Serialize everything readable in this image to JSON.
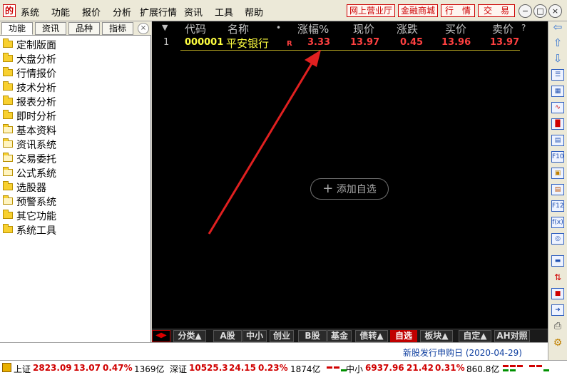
{
  "menu": {
    "logo_glyph": "的",
    "items": [
      "系统",
      "功能",
      "报价",
      "分析",
      "扩展行情",
      "资讯",
      "工具",
      "帮助"
    ],
    "quick_buttons": [
      "网上营业厅",
      "金融商城",
      "行　情",
      "交　易"
    ],
    "window_buttons": [
      "−",
      "□",
      "×"
    ]
  },
  "left_panel": {
    "tabs": [
      "功能",
      "资讯",
      "品种",
      "指标"
    ],
    "close_glyph": "×",
    "items": [
      {
        "label": "定制版面",
        "folder": "closed"
      },
      {
        "label": "大盘分析",
        "folder": "closed"
      },
      {
        "label": "行情报价",
        "folder": "closed"
      },
      {
        "label": "技术分析",
        "folder": "closed"
      },
      {
        "label": "报表分析",
        "folder": "closed"
      },
      {
        "label": "即时分析",
        "folder": "closed"
      },
      {
        "label": "基本资料",
        "folder": "open"
      },
      {
        "label": "资讯系统",
        "folder": "open"
      },
      {
        "label": "交易委托",
        "folder": "open"
      },
      {
        "label": "公式系统",
        "folder": "open"
      },
      {
        "label": "选股器",
        "folder": "closed"
      },
      {
        "label": "预警系统",
        "folder": "open"
      },
      {
        "label": "其它功能",
        "folder": "closed"
      },
      {
        "label": "系统工具",
        "folder": "closed"
      }
    ]
  },
  "quote_table": {
    "sort_glyph": "▼",
    "headers": {
      "code": "代码",
      "name": "名称",
      "dot": "•",
      "change_pct": "涨幅%",
      "price": "现价",
      "change": "涨跌",
      "bid": "买价",
      "ask": "卖价",
      "help": "?"
    },
    "rows": [
      {
        "index": "1",
        "code": "000001",
        "name": "平安银行",
        "flag": "R",
        "change_pct": "3.33",
        "price": "13.97",
        "change": "0.45",
        "bid": "13.96",
        "ask": "13.97"
      }
    ],
    "add_button_label": "添加自选",
    "add_button_glyph": "+"
  },
  "bottom_tabs": {
    "nav_glyph": "◀▶",
    "tabs": [
      {
        "label": "分类▲"
      },
      {
        "label": "A股"
      },
      {
        "label": "中小"
      },
      {
        "label": "创业"
      },
      {
        "label": "B股"
      },
      {
        "label": "基金"
      },
      {
        "label": "债转▲"
      },
      {
        "label": "自选"
      },
      {
        "label": "板块▲"
      },
      {
        "label": "自定▲"
      },
      {
        "label": "AH对照"
      }
    ],
    "active_tab": "自选"
  },
  "info_strip": {
    "ipo_text": "新股发行申购日 (2020-04-29)"
  },
  "status_bar": {
    "sh": {
      "name": "上证",
      "index": "2823.09",
      "change": "13.07",
      "pct": "0.47%",
      "volume": "1369亿"
    },
    "sz": {
      "name": "深证",
      "index": "10525.3",
      "change": "24.15",
      "pct": "0.23%",
      "volume": "1874亿"
    },
    "zx": {
      "name": "中小",
      "index": "6937.96",
      "change": "21.42",
      "pct": "0.31%",
      "volume": "860.8亿"
    }
  },
  "colors": {
    "up": "#d00000",
    "code": "#ffff40",
    "name": "#ffff40",
    "price": "#ff4040",
    "active_tab": "#c00000",
    "arrow": "#e02020"
  },
  "right_toolbar": {
    "icons": [
      "arrow-left-icon",
      "arrow-up-icon",
      "arrow-down-icon",
      "quote-list-icon",
      "grid-icon",
      "line-chart-icon",
      "kline-icon",
      "report-icon",
      "f10-icon",
      "finance-icon",
      "info-icon",
      "f12-icon",
      "formula-icon",
      "target-icon",
      "folder-icon",
      "sort-icon",
      "select-icon",
      "login-icon",
      "print-icon",
      "settings-icon"
    ]
  }
}
